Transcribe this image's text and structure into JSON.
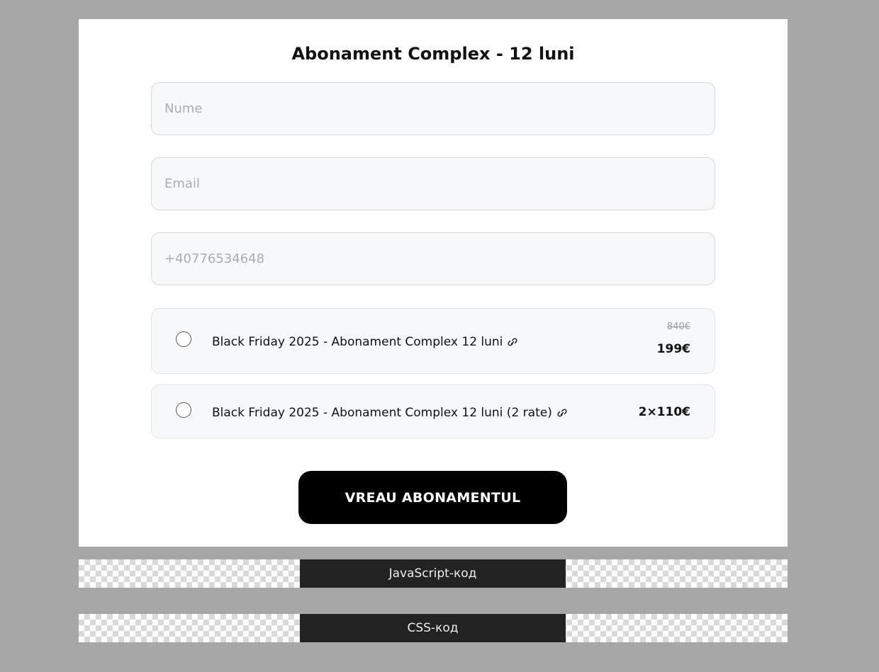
{
  "form": {
    "title": "Abonament Complex - 12 luni",
    "name_placeholder": "Nume",
    "email_placeholder": "Email",
    "phone_placeholder": "+40776534648",
    "options": [
      {
        "label": "Black Friday 2025 - Abonament Complex 12 luni",
        "old_price": "840€",
        "price": "199€",
        "icon": "link-icon"
      },
      {
        "label": "Black Friday 2025 - Abonament Complex 12 luni (2 rate)",
        "price": "2×110€",
        "icon": "link-icon"
      }
    ],
    "submit_label": "VREAU ABONAMENTUL"
  },
  "code_tabs": {
    "js_label": "JavaScript-код",
    "css_label": "CSS-код"
  },
  "colors": {
    "page_background": "#a7a7a7",
    "card_background": "#ffffff",
    "button_background": "#000000",
    "code_tab_background": "#222222"
  }
}
